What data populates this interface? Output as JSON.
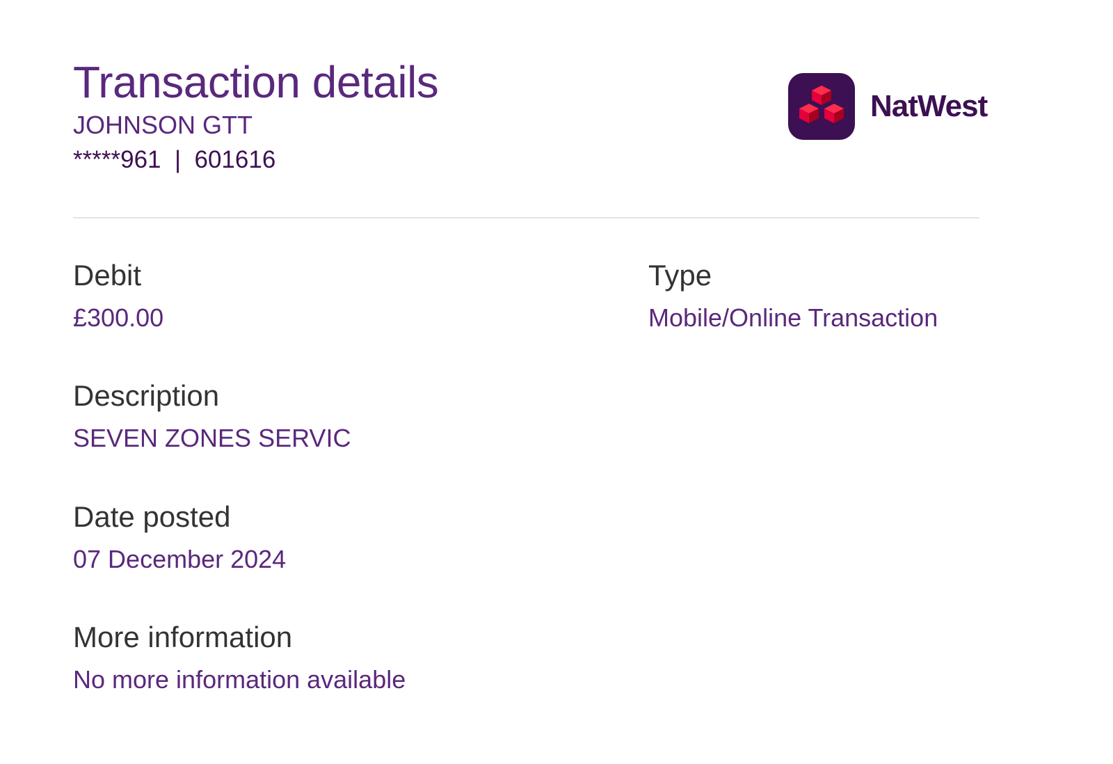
{
  "header": {
    "title": "Transaction details",
    "account_name": "JOHNSON GTT",
    "account_numbers": "*****961  |  601616"
  },
  "logo": {
    "brand": "NatWest",
    "icon": "natwest-cubes-icon",
    "colors": {
      "badge": "#3c1053",
      "cubes": "#e4003b"
    }
  },
  "details": {
    "debit": {
      "label": "Debit",
      "value": "£300.00"
    },
    "type": {
      "label": "Type",
      "value": "Mobile/Online Transaction"
    },
    "description": {
      "label": "Description",
      "value": "SEVEN ZONES SERVIC"
    },
    "date_posted": {
      "label": "Date posted",
      "value": "07 December 2024"
    },
    "more_info": {
      "label": "More information",
      "value": "No more information available"
    }
  },
  "colors": {
    "primary_purple": "#5a287d",
    "label_gray": "#333333",
    "divider": "#e3e3e3"
  }
}
